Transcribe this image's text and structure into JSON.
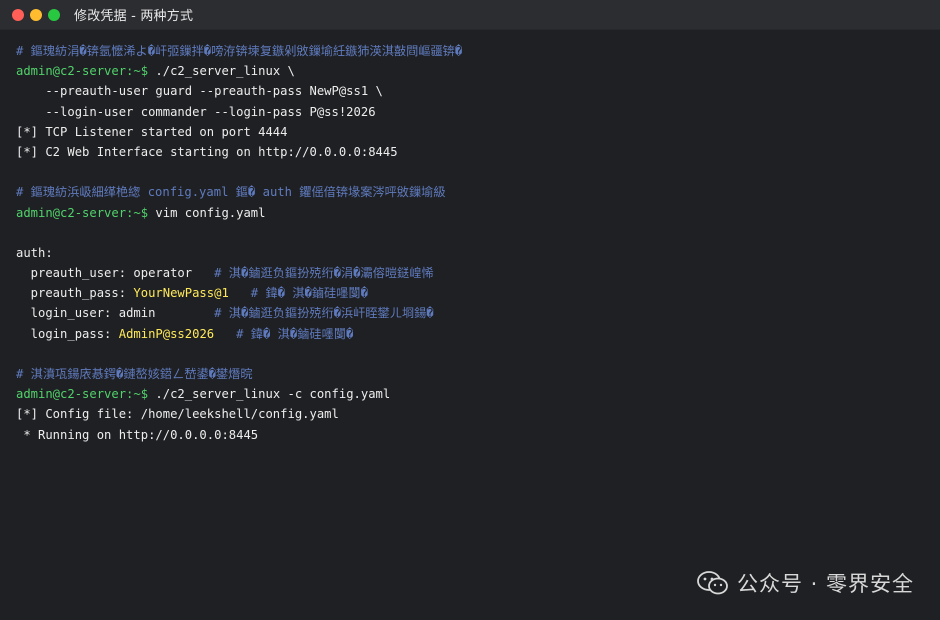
{
  "window": {
    "title": "修改凭据 - 两种方式",
    "colors": {
      "close": "#ff5f57",
      "minimize": "#febc2e",
      "zoom": "#28c840"
    }
  },
  "terminal": {
    "lines": [
      {
        "type": "comment",
        "text": "# 鏂瑰紡涓�锛氬懡浠よ�屽弬鏁拌�嗙洊锛堜复鏃剁敓鏁堬紝鏃犻渶淇敼閰嶇疆锛�"
      },
      {
        "type": "prompt",
        "prompt": "admin@c2-server:~$",
        "text": " ./c2_server_linux \\"
      },
      {
        "type": "plain",
        "text": "    --preauth-user guard --preauth-pass NewP@ss1 \\"
      },
      {
        "type": "plain",
        "text": "    --login-user commander --login-pass P@ss!2026"
      },
      {
        "type": "plain",
        "text": "[*] TCP Listener started on port 4444"
      },
      {
        "type": "plain",
        "text": "[*] C2 Web Interface starting on http://0.0.0.0:8445"
      },
      {
        "type": "blank",
        "text": ""
      },
      {
        "type": "comment",
        "text": "# 鏂瑰紡浜岋細缂栬緫 config.yaml 鏂� auth 鑺傜偣锛堟案涔呯敓鏁堬級"
      },
      {
        "type": "prompt",
        "prompt": "admin@c2-server:~$",
        "text": " vim config.yaml"
      },
      {
        "type": "blank",
        "text": ""
      },
      {
        "type": "plain",
        "text": "auth:"
      },
      {
        "type": "kv",
        "key": "  preauth_user:",
        "value": " operator",
        "valueClass": "plain",
        "comment": "   # 淇�鏀逛负鏂扮殑绗�涓�灞傛暟鎹崲悕"
      },
      {
        "type": "kv",
        "key": "  preauth_pass:",
        "value": " YourNewPass@1",
        "valueClass": "yellow",
        "comment": "   # 鍏� 淇�鏀硅嚜闅�"
      },
      {
        "type": "kv",
        "key": "  login_user:",
        "value": " admin",
        "valueClass": "plain",
        "comment": "        # 淇�鏀逛负鏂扮殑绗�浜屽眰鐢ㄦ埛鍚�"
      },
      {
        "type": "kv",
        "key": "  login_pass:",
        "value": " AdminP@ss2026",
        "valueClass": "yellow",
        "comment": "   # 鍏� 淇�鏀硅嚜闅�"
      },
      {
        "type": "blank",
        "text": ""
      },
      {
        "type": "comment",
        "text": "# 淇濆瓨鍚庡惎鍔�鏈嶅姟鍣ㄥ嵆鍙�鐢熸晥"
      },
      {
        "type": "prompt",
        "prompt": "admin@c2-server:~$",
        "text": " ./c2_server_linux -c config.yaml"
      },
      {
        "type": "plain",
        "text": "[*] Config file: /home/leekshell/config.yaml"
      },
      {
        "type": "plain",
        "text": " * Running on http://0.0.0.0:8445"
      }
    ]
  },
  "watermark": {
    "text": "公众号 · 零界安全",
    "icon": "wechat-icon"
  }
}
